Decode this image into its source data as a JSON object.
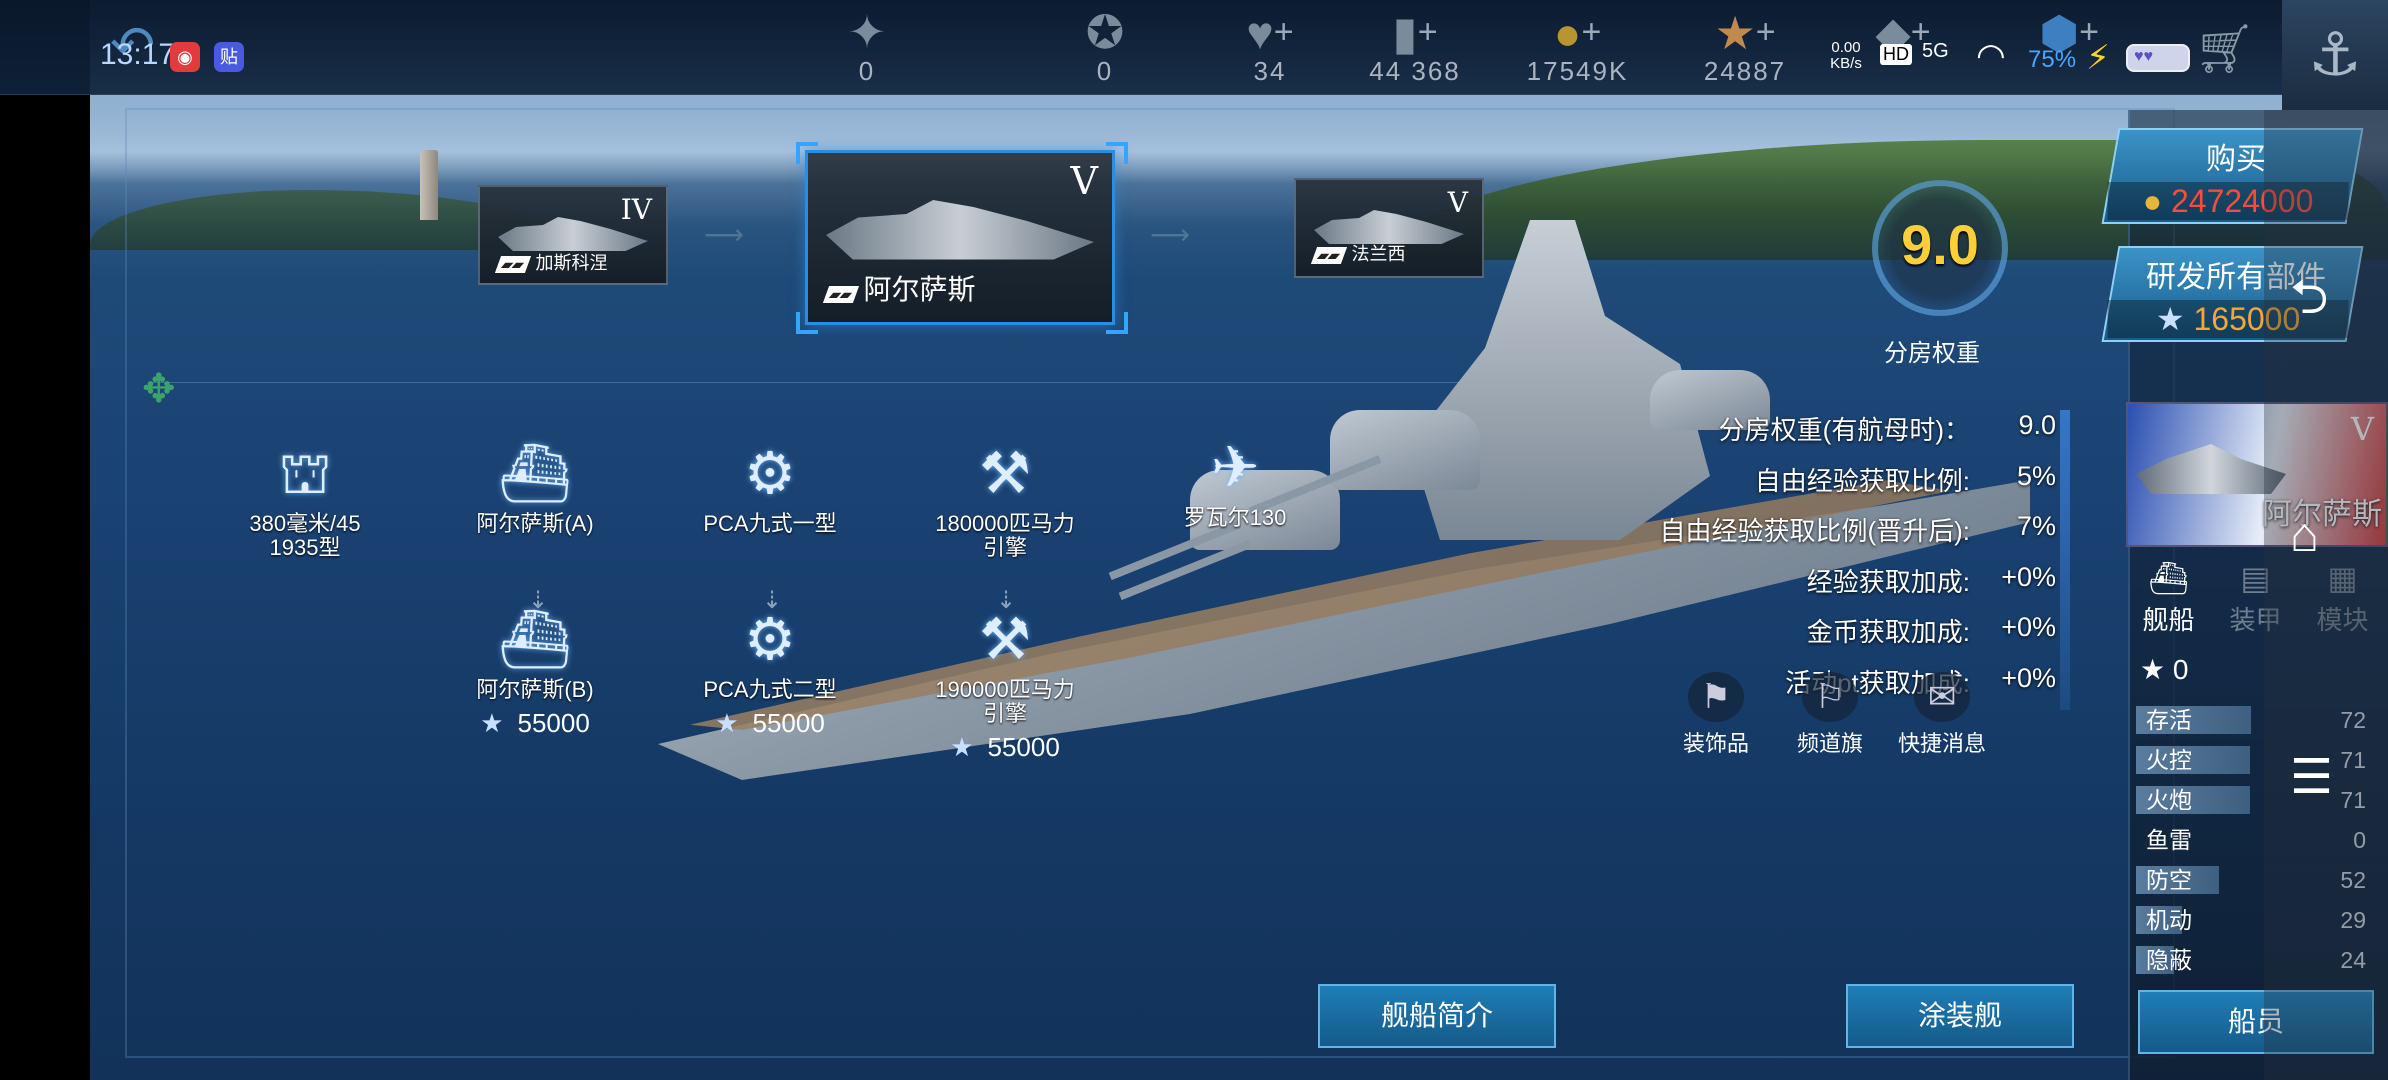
{
  "status_bar": {
    "time": "13:17",
    "net_speed": "0.00 KB/s",
    "hd": "HD",
    "signal": "5G",
    "battery_pct": "75%"
  },
  "resources": [
    {
      "icon": "rank-badge-icon",
      "value": "0",
      "plus": false
    },
    {
      "icon": "compass-icon",
      "value": "0",
      "plus": false
    },
    {
      "icon": "heart-icon",
      "value": "34",
      "plus": true
    },
    {
      "icon": "card-icon",
      "value": "44 368",
      "plus": true
    },
    {
      "icon": "gold-coin-icon",
      "value": "17549K",
      "plus": true
    },
    {
      "icon": "star-icon",
      "value": "24887",
      "plus": true
    },
    {
      "icon": "diamond-icon",
      "value": "",
      "plus": true
    },
    {
      "icon": "shield-gem-icon",
      "value": "",
      "plus": true
    }
  ],
  "ship_cards": [
    {
      "tier": "IV",
      "name": "加斯科涅"
    },
    {
      "tier": "V",
      "name": "阿尔萨斯",
      "selected": true
    },
    {
      "tier": "V",
      "name": "法兰西"
    }
  ],
  "upgrade_nodes": [
    {
      "name": "380毫米/45\n1935型",
      "glyph": "gun-turret-icon"
    },
    {
      "name": "阿尔萨斯(A)",
      "glyph": "hull-icon"
    },
    {
      "name": "PCA九式一型",
      "glyph": "fire-control-icon"
    },
    {
      "name": "180000匹马力\n引擎",
      "glyph": "engine-icon"
    },
    {
      "name": "罗瓦尔130",
      "glyph": "seaplane-icon"
    },
    {
      "name": "阿尔萨斯(B)",
      "glyph": "hull-icon",
      "cost": "55000"
    },
    {
      "name": "PCA九式二型",
      "glyph": "fire-control-icon",
      "cost": "55000"
    },
    {
      "name": "190000匹马力\n引擎",
      "glyph": "engine-icon",
      "cost": "55000"
    }
  ],
  "matchmaking": {
    "value": "9.0",
    "label": "分房权重"
  },
  "stats": [
    {
      "label": "分房权重(有航母时)：",
      "value": "9.0"
    },
    {
      "label": "自由经验获取比例:",
      "value": "5%"
    },
    {
      "label": "自由经验获取比例(晋升后):",
      "value": "7%"
    },
    {
      "label": "经验获取加成:",
      "value": "+0%"
    },
    {
      "label": "金币获取加成:",
      "value": "+0%"
    },
    {
      "label": "活动pt获取加成:",
      "value": "+0%"
    }
  ],
  "quick_actions": [
    {
      "label": "装饰品",
      "icon": "flag-icon"
    },
    {
      "label": "频道旗",
      "icon": "channel-flag-icon"
    },
    {
      "label": "快捷消息",
      "icon": "chat-icon"
    }
  ],
  "bottom_buttons": {
    "intro": "舰船简介",
    "paint": "涂装舰"
  },
  "side": {
    "buy_label": "购买",
    "buy_price": "24724000",
    "research_label": "研发所有部件",
    "research_cost": "165000",
    "thumb_tier": "V",
    "thumb_name": "阿尔萨斯",
    "tabs": [
      "舰船",
      "装甲",
      "模块"
    ],
    "star_count": "0",
    "attributes": [
      {
        "label": "存活",
        "value": "72",
        "ratio": 0.72
      },
      {
        "label": "火控",
        "value": "71",
        "ratio": 0.71
      },
      {
        "label": "火炮",
        "value": "71",
        "ratio": 0.71
      },
      {
        "label": "鱼雷",
        "value": "0",
        "ratio": 0.0
      },
      {
        "label": "防空",
        "value": "52",
        "ratio": 0.52
      },
      {
        "label": "机动",
        "value": "29",
        "ratio": 0.29
      },
      {
        "label": "隐蔽",
        "value": "24",
        "ratio": 0.24
      }
    ],
    "crew_label": "船员"
  }
}
